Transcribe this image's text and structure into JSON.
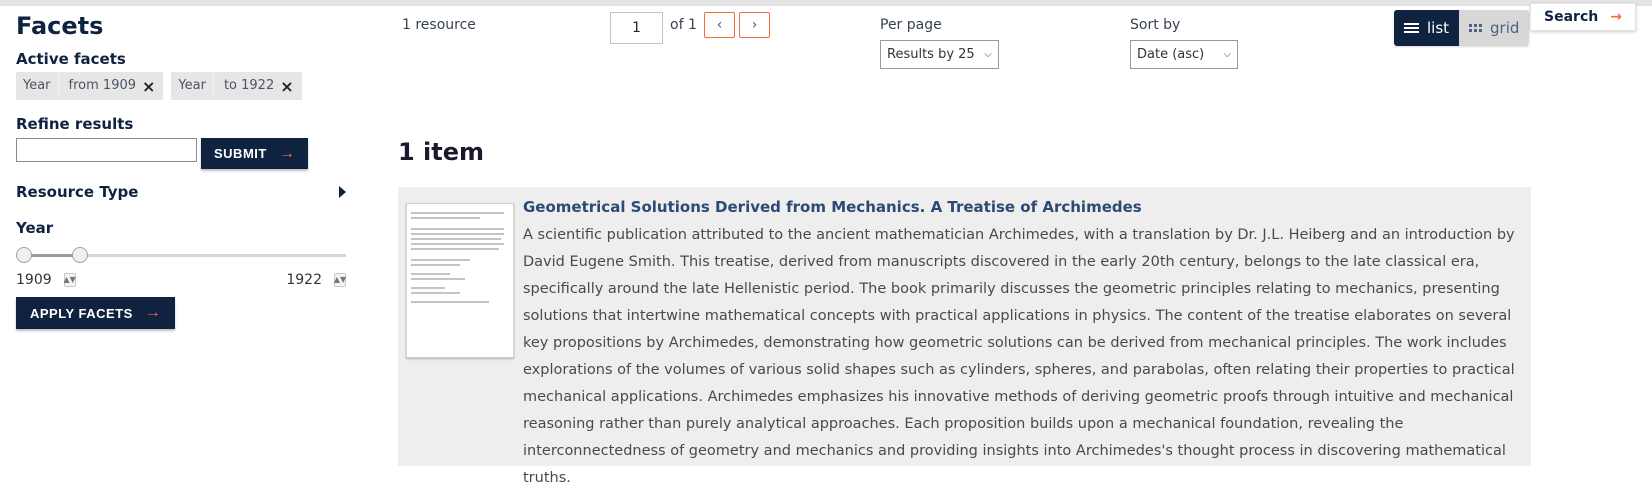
{
  "sidebar": {
    "title": "Facets",
    "active_facets_label": "Active facets",
    "active_facets": [
      {
        "key": "Year",
        "value": "from 1909"
      },
      {
        "key": "Year",
        "value": "to 1922"
      }
    ],
    "refine_label": "Refine results",
    "refine_value": "",
    "submit_label": "SUBMIT",
    "resource_type_label": "Resource Type",
    "year_label": "Year",
    "year_min": "1909",
    "year_max": "1922",
    "apply_label": "APPLY FACETS"
  },
  "toolbar": {
    "resource_count": "1 resource",
    "page_value": "1",
    "page_of": "of 1",
    "per_page_label": "Per page",
    "per_page_value": "Results by 25",
    "sort_label": "Sort by",
    "sort_value": "Date (asc)",
    "view_list_label": "list",
    "view_grid_label": "grid",
    "search_label": "Search"
  },
  "results": {
    "heading": "1 item",
    "items": [
      {
        "title": "Geometrical Solutions Derived from Mechanics. A Treatise of Archimedes",
        "description": "A scientific publication attributed to the ancient mathematician Archimedes, with a translation by Dr. J.L. Heiberg and an introduction by David Eugene Smith. This treatise, derived from manuscripts discovered in the early 20th century, belongs to the late classical era, specifically around the late Hellenistic period. The book primarily discusses the geometric principles relating to mechanics, presenting solutions that intertwine mathematical concepts with practical applications in physics. The content of the treatise elaborates on several key propositions by Archimedes, demonstrating how geometric solutions can be derived from mechanical principles. The work includes explorations of the volumes of various solid shapes such as cylinders, spheres, and parabolas, often relating their properties to practical mechanical applications. Archimedes emphasizes his innovative methods of deriving geometric proofs through intuitive and mechanical reasoning rather than purely analytical approaches. Each proposition builds upon a mechanical foundation, revealing the interconnectedness of geometry and mechanics and providing insights into Archimedes's thought process in discovering mathematical truths."
      }
    ]
  },
  "colors": {
    "navy": "#0f2340",
    "accent": "#f26b3a",
    "link": "#2c4a73"
  }
}
